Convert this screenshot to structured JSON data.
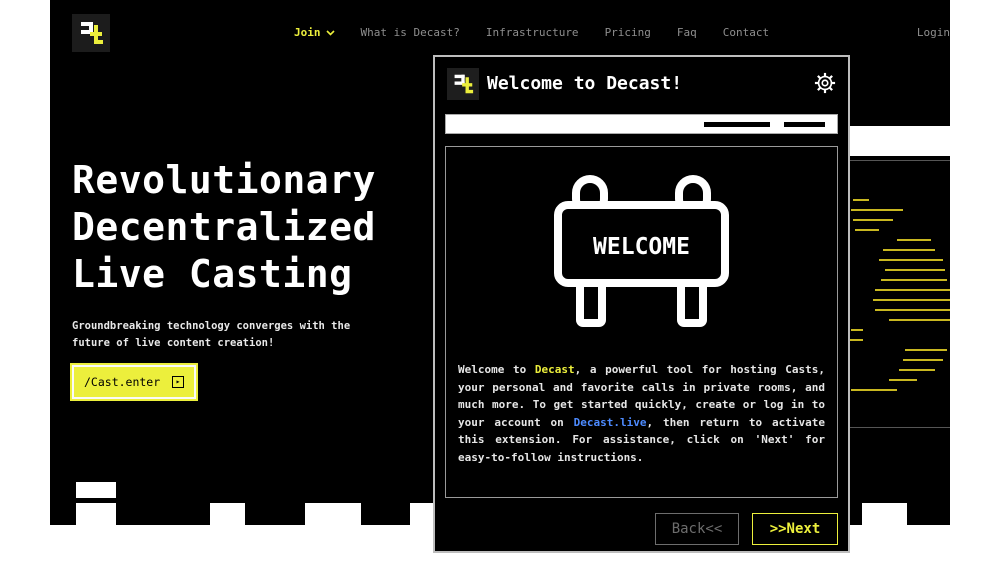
{
  "nav": {
    "join": "Join",
    "items": [
      "What is Decast?",
      "Infrastructure",
      "Pricing",
      "Faq",
      "Contact"
    ],
    "login": "Login"
  },
  "hero": {
    "title_lines": [
      "Revolutionary",
      "Decentralized",
      "Live Casting"
    ],
    "subtitle": "Groundbreaking technology converges with the future of live content creation!",
    "cta_label": "/Cast.enter",
    "cta_icon": "▸"
  },
  "popup": {
    "title": "Welcome to Decast!",
    "sign_text": "WELCOME",
    "text": {
      "p1": "Welcome to ",
      "brand": "Decast",
      "p2": ", a powerful tool for hosting Casts, your personal and favorite calls in private rooms, and much more. To get started quickly, create or log in to your account on ",
      "link": "Decast.live",
      "p3": ", then return to activate this extension. For assistance, click on 'Next' for easy-to-follow instructions."
    },
    "back_label": "Back<<",
    "next_label": ">>Next"
  },
  "colors": {
    "accent": "#ecef3c",
    "link": "#4d8bff",
    "background": "#000000"
  },
  "icons": {
    "logo": "decast-logo-icon",
    "dropdown": "chevron-down-icon",
    "settings": "gear-icon",
    "sign": "welcome-sign-icon",
    "cta": "arrow-box-icon"
  }
}
